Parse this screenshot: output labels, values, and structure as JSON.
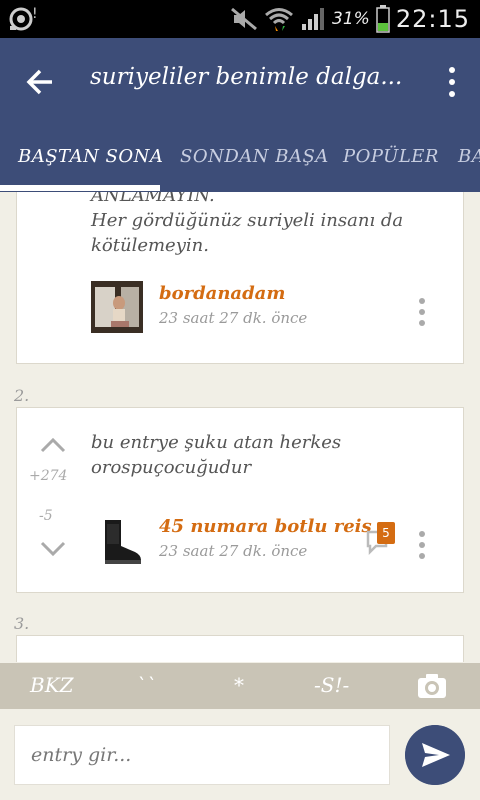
{
  "status_bar": {
    "battery_percent": "31%",
    "time": "22:15"
  },
  "header": {
    "title": "suriyeliler benimle dalga...",
    "back_icon": "arrow-left-icon",
    "menu_icon": "more-vert-icon"
  },
  "tabs": [
    {
      "label": "BAŞTAN SONA",
      "active": true
    },
    {
      "label": "SONDAN BAŞA",
      "active": false
    },
    {
      "label": "POPÜLER",
      "active": false
    },
    {
      "label": "BA",
      "active": false
    }
  ],
  "entries": [
    {
      "text_lines": [
        "ANLAMAYIN.",
        "Her gördüğünüz suriyeli insanı da",
        "kötülemeyin."
      ],
      "author": "bordanadam",
      "date": "23 saat 27 dk. önce"
    },
    {
      "number": "2.",
      "text_lines": [
        "bu entrye şuku atan herkes",
        "orospuçocuğudur"
      ],
      "upvotes": "+274",
      "downvotes": "-5",
      "author": "45 numara botlu reis",
      "date": "23 saat 27 dk. önce",
      "comment_count": "5"
    },
    {
      "number": "3."
    }
  ],
  "toolbar": {
    "bkz": "BKZ",
    "quote": "``",
    "star": "*",
    "spoiler": "-S!-"
  },
  "input": {
    "placeholder": "entry gir..."
  },
  "colors": {
    "header": "#3d4d78",
    "author": "#d46c12",
    "background": "#f1efe6"
  }
}
